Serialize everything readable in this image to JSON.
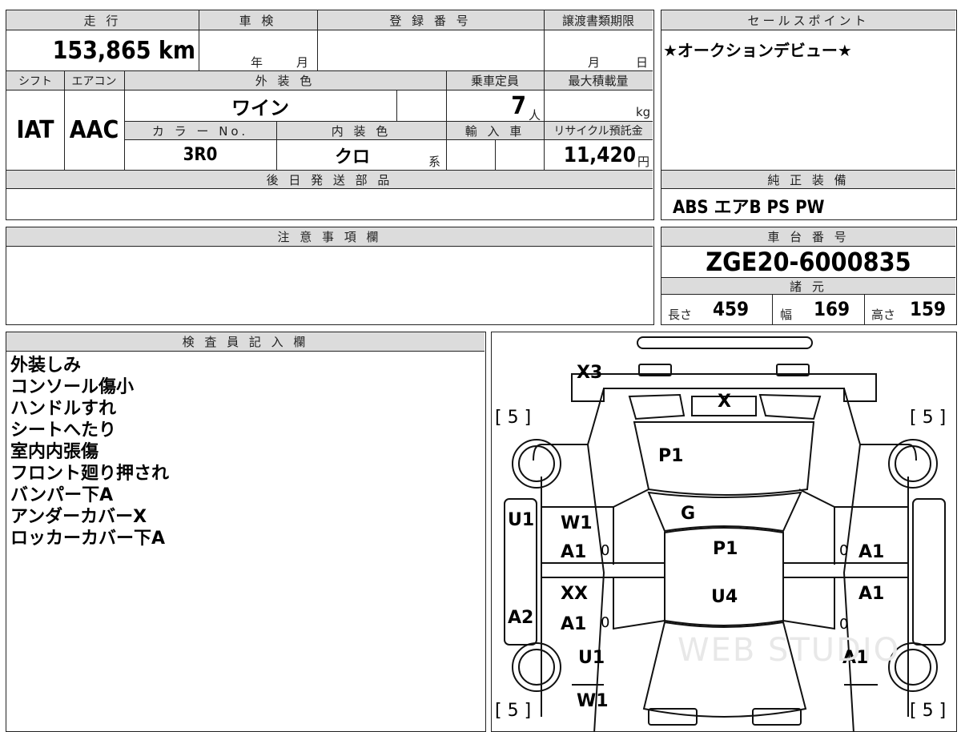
{
  "top": {
    "mileage_label": "走 行",
    "mileage_value": "153,865",
    "mileage_unit": "km",
    "inspection_label": "車 検",
    "inspection_year": "年",
    "inspection_month": "月",
    "registration_label": "登 録 番 号",
    "transfer_label": "譲渡書類期限",
    "transfer_month": "月",
    "transfer_day": "日"
  },
  "specs": {
    "shift_label": "シフト",
    "shift_value": "IAT",
    "ac_label": "エアコン",
    "ac_value": "AAC",
    "ext_color_label": "外 装 色",
    "ext_color_value": "ワイン",
    "capacity_label": "乗車定員",
    "capacity_value": "7",
    "capacity_unit": "人",
    "maxload_label": "最大積載量",
    "maxload_unit": "kg",
    "color_no_label": "カ ラ ー No.",
    "color_no_value": "3R0",
    "int_color_label": "内 装 色",
    "int_color_value": "クロ",
    "int_color_suffix": "系",
    "import_label": "輸 入 車",
    "recycle_label": "リサイクル預託金",
    "recycle_value": "11,420",
    "recycle_unit": "円"
  },
  "later_parts": {
    "label": "後 日 発 送 部 品",
    "value": ""
  },
  "sales_point": {
    "label": "セールスポイント",
    "value": "★オークションデビュー★"
  },
  "equipment": {
    "label": "純 正 装 備",
    "value": "ABS エアB PS PW"
  },
  "caution": {
    "label": "注 意 事 項 欄"
  },
  "chassis": {
    "label": "車 台 番 号",
    "value": "ZGE20-6000835"
  },
  "dims": {
    "label": "諸 元",
    "length_label": "長さ",
    "length_value": "459",
    "width_label": "幅",
    "width_value": "169",
    "height_label": "高さ",
    "height_value": "159"
  },
  "inspector": {
    "label": "検 査 員 記 入 欄",
    "notes": [
      "外装しみ",
      "コンソール傷小",
      "ハンドルすれ",
      "シートへたり",
      "室内内張傷",
      "フロント廻り押され",
      "バンパー下A",
      "アンダーカバーX",
      "ロッカーカバー下A"
    ]
  },
  "diagram": {
    "bracket_tl": "[ 5 ]",
    "bracket_tr": "[ 5 ]",
    "bracket_bl": "[ 5 ]",
    "bracket_br": "[ 5 ]",
    "front_bumper": "X3",
    "grille": "X",
    "hood": "P1",
    "windshield": "G",
    "roof": "P1",
    "rear_roof": "U4",
    "left_fender_top": "U1",
    "left_front_door": "W1",
    "left_front_door2": "A1",
    "left_front_door_zero": "0",
    "left_rear_door": "XX",
    "left_rear_door2": "A1",
    "left_rear_door_zero": "0",
    "left_rocker": "A2",
    "left_rear_fender": "U1",
    "left_rear_bottom": "W1",
    "right_front_door_zero": "0",
    "right_front_door": "A1",
    "right_rear_door": "A1",
    "right_rear_door_zero": "0",
    "right_rear_fender": "A1",
    "watermark": "WEB STUDIO"
  }
}
